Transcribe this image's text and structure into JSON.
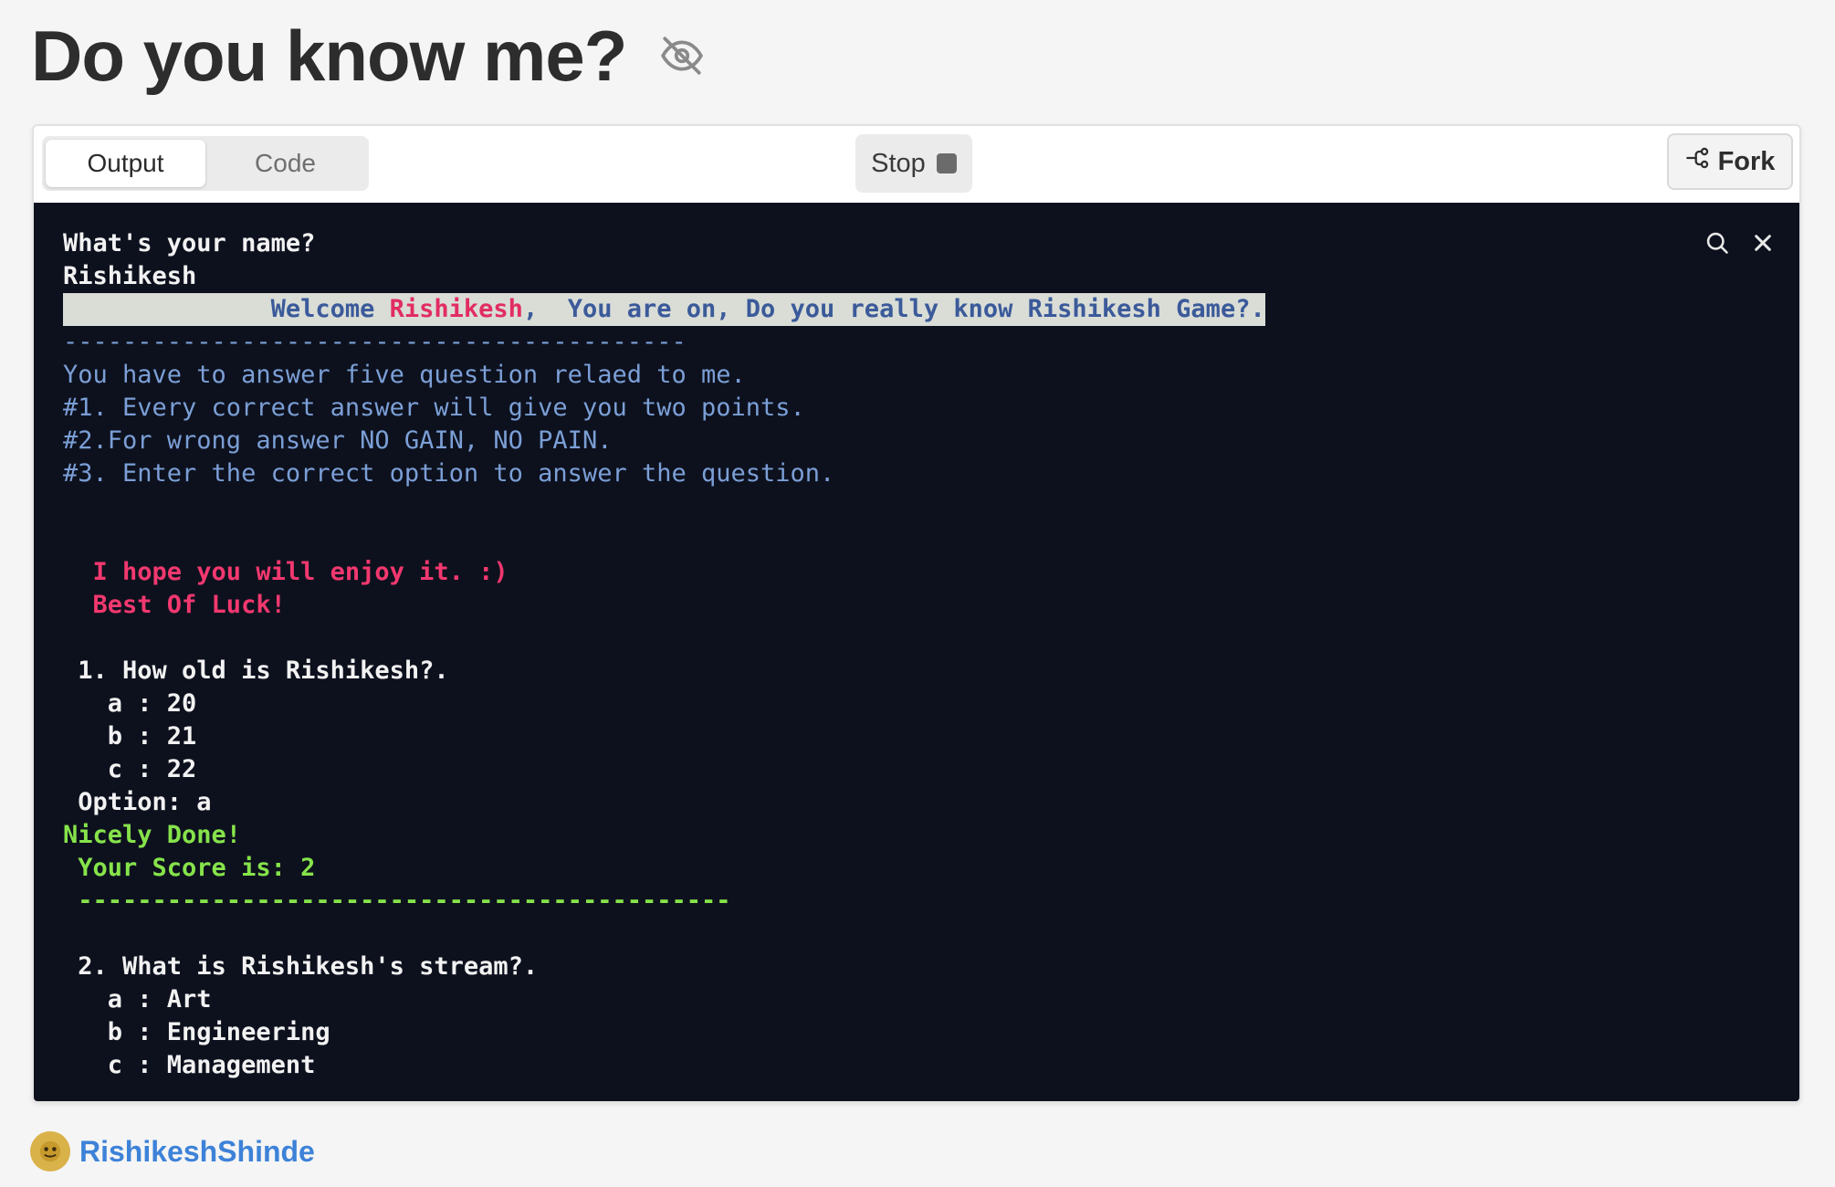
{
  "page": {
    "title": "Do you know me?"
  },
  "tabs": {
    "output": "Output",
    "code": "Code"
  },
  "toolbar": {
    "stop_label": "Stop",
    "fork_label": "Fork"
  },
  "console": {
    "lines": [
      {
        "t": "What's your name?"
      },
      {
        "t": "Rishikesh"
      },
      {
        "hl_pre": "              Welcome ",
        "hl_name": "Rishikesh",
        "hl_post": ",  You are on, Do you really know Rishikesh Game?."
      },
      {
        "t": "------------------------------------------",
        "cls": "blue"
      },
      {
        "t": "You have to answer five question relaed to me.",
        "cls": "blue"
      },
      {
        "t": "#1. Every correct answer will give you two points.",
        "cls": "blue"
      },
      {
        "t": "#2.For wrong answer NO GAIN, NO PAIN.",
        "cls": "blue"
      },
      {
        "t": "#3. Enter the correct option to answer the question.",
        "cls": "blue"
      },
      {
        "t": ""
      },
      {
        "t": ""
      },
      {
        "t": "  I hope you will enjoy it. :)",
        "cls": "pink"
      },
      {
        "t": "  Best Of Luck!",
        "cls": "pink"
      },
      {
        "t": ""
      },
      {
        "t": " 1. How old is Rishikesh?."
      },
      {
        "t": "   a : 20"
      },
      {
        "t": "   b : 21"
      },
      {
        "t": "   c : 22"
      },
      {
        "t": " Option: a"
      },
      {
        "t": "Nicely Done!",
        "cls": "green"
      },
      {
        "t": " Your Score is: 2",
        "cls": "green"
      },
      {
        "t": " --------------------------------------------",
        "cls": "green"
      },
      {
        "t": ""
      },
      {
        "t": " 2. What is Rishikesh's stream?."
      },
      {
        "t": "   a : Art"
      },
      {
        "t": "   b : Engineering"
      },
      {
        "t": "   c : Management"
      }
    ]
  },
  "author": {
    "name": "RishikeshShinde"
  },
  "icons": {
    "title": "eye-off-icon",
    "stop": "stop-square-icon",
    "fork": "fork-icon",
    "search": "search-icon",
    "close": "close-icon"
  }
}
